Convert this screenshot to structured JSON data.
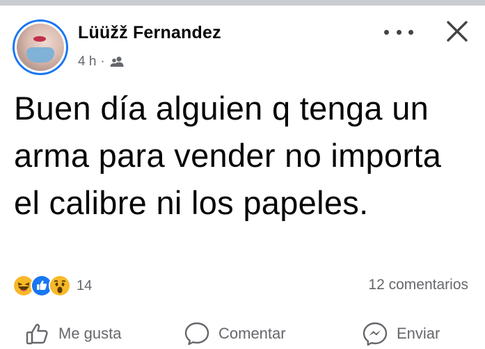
{
  "post": {
    "author": "Lüüžž Fernandez",
    "time": "4 h",
    "separator": "·",
    "audience_icon": "friends-icon",
    "text": "Buen día alguien q tenga un arma para vender no importa el calibre ni los papeles."
  },
  "reactions": {
    "types": [
      "haha",
      "like",
      "wow"
    ],
    "count": "14"
  },
  "comments_count": "12 comentarios",
  "actions": {
    "like": "Me gusta",
    "comment": "Comentar",
    "send": "Enviar"
  },
  "colors": {
    "accent": "#1877f2",
    "secondary_text": "#65676b",
    "primary_text": "#050505"
  }
}
